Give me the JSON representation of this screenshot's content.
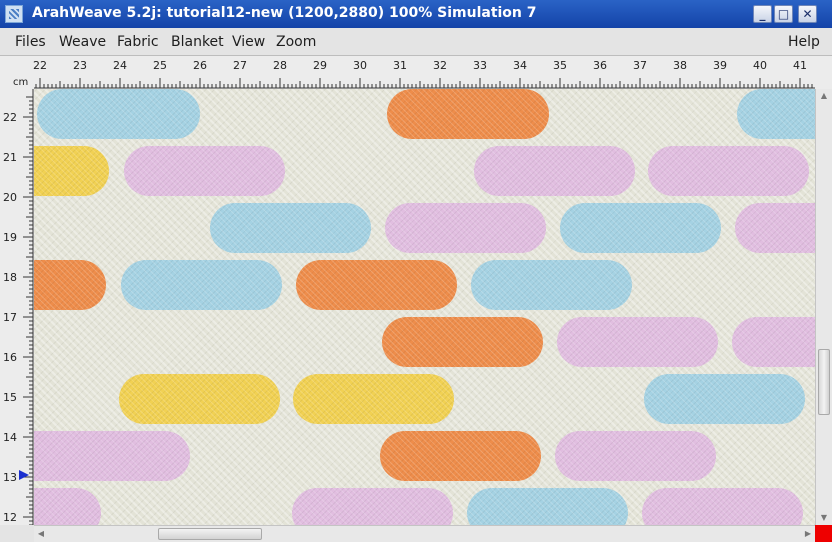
{
  "window": {
    "title": "ArahWeave 5.2j: tutorial12-new (1200,2880) 100% Simulation 7",
    "minimize_glyph": "_",
    "maximize_glyph": "□",
    "close_glyph": "✕"
  },
  "menu": {
    "items": [
      "Files",
      "Weave",
      "Fabric",
      "Blanket",
      "View",
      "Zoom"
    ],
    "help": "Help"
  },
  "ruler": {
    "unit": "cm",
    "horizontal_labels": [
      "22",
      "23",
      "24",
      "25",
      "26",
      "27",
      "28",
      "29",
      "30",
      "31",
      "32",
      "33",
      "34",
      "35",
      "36",
      "37",
      "38",
      "39",
      "40",
      "41"
    ],
    "vertical_labels": [
      "22",
      "21",
      "20",
      "19",
      "18",
      "17",
      "16",
      "15",
      "14",
      "13",
      "12"
    ],
    "position_marker_label": "13"
  },
  "colors": {
    "blue": "#a5d2e3",
    "orange": "#ee8d4b",
    "pink": "#e1bee0",
    "yellow": "#f1d153",
    "background": "#e3e3d7",
    "corner": "#ee0000"
  },
  "fabric": {
    "row_colors": [
      [
        "blue",
        "orange",
        "blue"
      ],
      [
        "yellow",
        "pink",
        "pink",
        "pink"
      ],
      [
        "blue",
        "pink",
        "blue",
        "pink"
      ],
      [
        "orange",
        "blue",
        "orange",
        "blue"
      ],
      [
        "orange",
        "pink",
        "pink"
      ],
      [
        "yellow",
        "yellow",
        "blue"
      ],
      [
        "pink",
        "orange",
        "pink"
      ],
      [
        "pink",
        "pink",
        "blue",
        "pink"
      ]
    ]
  },
  "scroll": {
    "vertical_fraction": 0.72,
    "horizontal_fraction": 0.17
  }
}
